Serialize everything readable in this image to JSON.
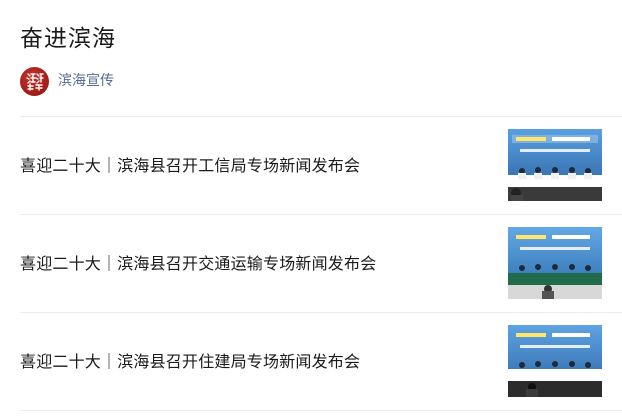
{
  "header": {
    "title": "奋进滨海"
  },
  "account": {
    "avatar_text": "滨海宣传",
    "name": "滨海宣传"
  },
  "articles": [
    {
      "title": "喜迎二十大｜滨海县召开工信局专场新闻发布会",
      "thumb_banner": "勇当排头兵 奋进向未来",
      "thumb_subtitle": "滨海县系列新闻发布会（工信局专场）"
    },
    {
      "title": "喜迎二十大｜滨海县召开交通运输专场新闻发布会",
      "thumb_banner": "勇当排头兵 奋进向未来",
      "thumb_subtitle": "滨海县系列新闻发布会（交通运输专场）"
    },
    {
      "title": "喜迎二十大｜滨海县召开住建局专场新闻发布会",
      "thumb_banner": "勇当排头兵 奋进向未来",
      "thumb_subtitle": "滨海县系列新闻发布会（住建局专场）"
    }
  ],
  "colors": {
    "link": "#576b95",
    "divider": "#ececec",
    "avatar_red": "#a11c17",
    "thumb_blue": "#3f7fc0"
  }
}
